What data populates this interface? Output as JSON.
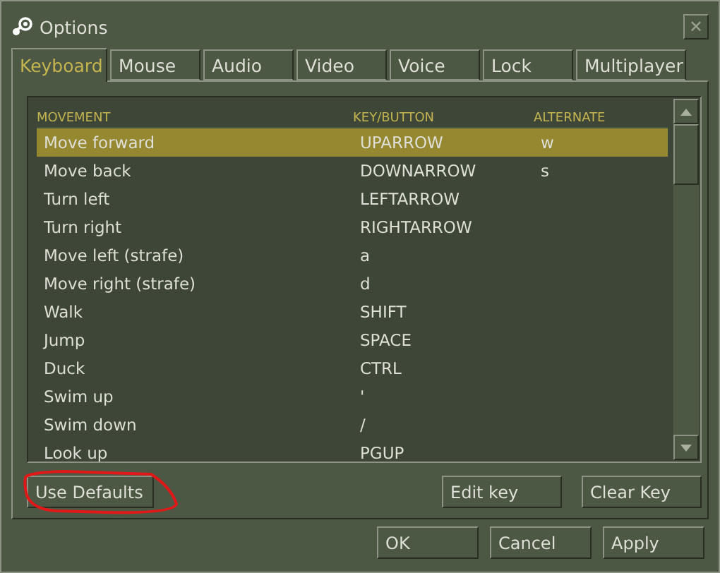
{
  "window": {
    "title": "Options",
    "close": "✕"
  },
  "tabs": [
    {
      "label": "Keyboard",
      "selected": true
    },
    {
      "label": "Mouse",
      "selected": false
    },
    {
      "label": "Audio",
      "selected": false
    },
    {
      "label": "Video",
      "selected": false
    },
    {
      "label": "Voice",
      "selected": false
    },
    {
      "label": "Lock",
      "selected": false
    },
    {
      "label": "Multiplayer",
      "selected": false
    }
  ],
  "table": {
    "columns": [
      "MOVEMENT",
      "KEY/BUTTON",
      "ALTERNATE"
    ],
    "rows": [
      {
        "cells": [
          "Move forward",
          "UPARROW",
          "w"
        ],
        "selected": true
      },
      {
        "cells": [
          "Move back",
          "DOWNARROW",
          "s"
        ],
        "selected": false
      },
      {
        "cells": [
          "Turn left",
          "LEFTARROW"
        ],
        "selected": false
      },
      {
        "cells": [
          "Turn right",
          "RIGHTARROW"
        ],
        "selected": false
      },
      {
        "cells": [
          "Move left (strafe)",
          "a"
        ],
        "selected": false
      },
      {
        "cells": [
          "Move right (strafe)",
          "d"
        ],
        "selected": false
      },
      {
        "cells": [
          "Walk",
          "SHIFT"
        ],
        "selected": false
      },
      {
        "cells": [
          "Jump",
          "SPACE"
        ],
        "selected": false
      },
      {
        "cells": [
          "Duck",
          "CTRL"
        ],
        "selected": false
      },
      {
        "cells": [
          "Swim up",
          "'"
        ],
        "selected": false
      },
      {
        "cells": [
          "Swim down",
          "/"
        ],
        "selected": false
      },
      {
        "cells": [
          "Look up",
          "PGUP"
        ],
        "selected": false
      }
    ]
  },
  "panel_buttons": [
    "Use Defaults",
    "Edit key",
    "Clear Key"
  ],
  "dialog_buttons": [
    "OK",
    "Cancel",
    "Apply"
  ]
}
